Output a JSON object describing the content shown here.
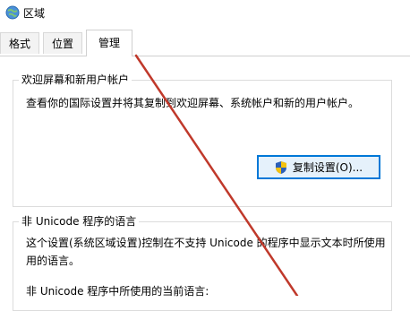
{
  "window": {
    "title": "区域",
    "icon": "globe-icon"
  },
  "tabs": [
    {
      "label": "格式",
      "active": false
    },
    {
      "label": "位置",
      "active": false
    },
    {
      "label": "管理",
      "active": true
    }
  ],
  "welcome_group": {
    "title": "欢迎屏幕和新用户帐户",
    "description": "查看你的国际设置并将其复制到欢迎屏幕、系统帐户和新的用户帐户。",
    "copy_button_label": "复制设置(O)...",
    "copy_button_icon": "uac-shield-icon"
  },
  "non_unicode_group": {
    "title": "非 Unicode 程序的语言",
    "description_line1": "这个设置(系统区域设置)控制在不支持 Unicode 的程序中显示文本时所使用",
    "description_line2": "用的语言。",
    "current_language_label": "非 Unicode 程序中所使用的当前语言:"
  },
  "colors": {
    "annotation_line": "#c0392b",
    "button_focus_border": "#0078d7"
  }
}
